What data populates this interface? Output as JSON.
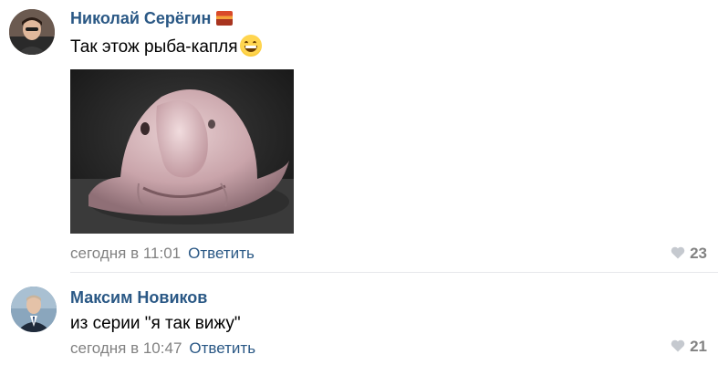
{
  "comments": [
    {
      "author": "Николай Серёгин",
      "text": "Так этож рыба-капля",
      "time": "сегодня в 11:01",
      "reply_label": "Ответить",
      "likes": "23"
    },
    {
      "author": "Максим Новиков",
      "text": "из серии \"я так вижу\"",
      "time": "сегодня в 10:47",
      "reply_label": "Ответить",
      "likes": "21"
    }
  ],
  "icons": {
    "heart": "heart-icon",
    "emoji": "grinning-face-emoji",
    "flag": "sunset-flag-icon"
  },
  "colors": {
    "author": "#2a5885",
    "meta": "#828282",
    "divider": "#e7e8ec"
  }
}
